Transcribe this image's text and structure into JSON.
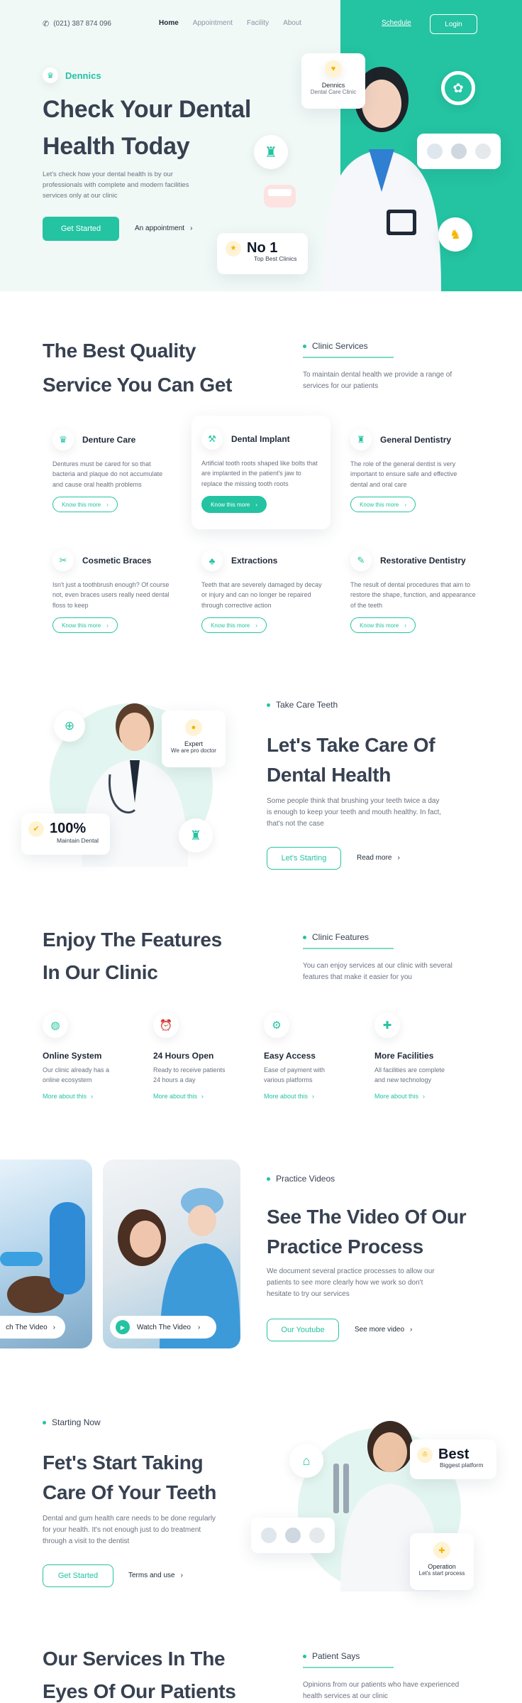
{
  "header": {
    "phone": "(021) 387 874 096",
    "nav": [
      "Home",
      "Appointment",
      "Facility",
      "About"
    ],
    "schedule": "Schedule",
    "login": "Login"
  },
  "hero": {
    "brand": "Dennics",
    "title_line1": "Check Your Dental",
    "title_line2": "Health Today",
    "description": "Let's check how your dental health is by our professionals with complete and modern facilities services only at our clinic",
    "cta_primary": "Get Started",
    "cta_secondary": "An appointment",
    "badge_brand_title": "Dennics",
    "badge_brand_sub": "Dental Care Clinic",
    "badge_no1_title": "No 1",
    "badge_no1_sub": "Top Best Clinics"
  },
  "services": {
    "title_line1": "The Best Quality",
    "title_line2": "Service You Can Get",
    "tag": "Clinic Services",
    "intro": "To maintain dental health we provide a range of services for our patients",
    "link_label": "Know this more",
    "items": [
      {
        "name": "Denture Care",
        "desc": "Dentures must be cared for so that bacteria and plaque do not accumulate and cause oral health problems",
        "icon": "denture-icon"
      },
      {
        "name": "Dental Implant",
        "desc": "Artificial tooth roots shaped like bolts that are implanted in the patient's jaw to replace the missing tooth roots",
        "icon": "implant-icon"
      },
      {
        "name": "General Dentistry",
        "desc": "The role of the general dentist is very important to ensure safe and effective dental and oral care",
        "icon": "tooth-icon"
      },
      {
        "name": "Cosmetic Braces",
        "desc": "Isn't just a toothbrush enough? Of course not, even braces users really need dental floss to keep",
        "icon": "braces-icon"
      },
      {
        "name": "Extractions",
        "desc": "Teeth that are severely damaged by decay or injury and can no longer be repaired through corrective action",
        "icon": "extraction-icon"
      },
      {
        "name": "Restorative Dentistry",
        "desc": "The result of dental procedures that aim to restore the shape, function, and appearance of the teeth",
        "icon": "restore-icon"
      }
    ]
  },
  "care": {
    "tag": "Take Care Teeth",
    "title_line1": "Let's Take Care Of",
    "title_line2": "Dental Health",
    "desc": "Some people think that brushing your teeth twice a day is enough to keep your teeth and mouth healthy. In fact, that's not the case",
    "cta_primary": "Let's Starting",
    "cta_secondary": "Read more",
    "badge_expert_title": "Expert",
    "badge_expert_sub": "We are pro doctor",
    "badge_pct_title": "100%",
    "badge_pct_sub": "Maintain Dental"
  },
  "features": {
    "title_line1": "Enjoy The Features",
    "title_line2": "In Our Clinic",
    "tag": "Clinic Features",
    "intro": "You can enjoy services at our clinic with several features that make it easier for you",
    "link_label": "More about this",
    "items": [
      {
        "name": "Online System",
        "desc": "Our clinic already has a online ecosystem",
        "icon": "globe-icon"
      },
      {
        "name": "24 Hours Open",
        "desc": "Ready to receive patients 24 hours a day",
        "icon": "alarm-clock-icon"
      },
      {
        "name": "Easy Access",
        "desc": "Ease of payment with various platforms",
        "icon": "access-icon"
      },
      {
        "name": "More Facilities",
        "desc": "All facilities are complete and new technology",
        "icon": "first-aid-icon"
      }
    ]
  },
  "videos": {
    "tag": "Practice Videos",
    "title_line1": "See The Video Of Our",
    "title_line2": "Practice Process",
    "desc": "We document several practice processes to allow our patients to see more clearly how we work so don't hesitate to try our services",
    "cta_primary": "Our Youtube",
    "cta_secondary": "See more video",
    "watch_label_1": "ch The Video",
    "watch_label_2": "Watch The Video"
  },
  "start": {
    "tag": "Starting Now",
    "title_line1": "Fet's Start Taking",
    "title_line2": "Care Of Your Teeth",
    "desc": "Dental and gum health care needs to be done regularly for your health. It's not enough just to do treatment through a visit to the dentist",
    "cta_primary": "Get Started",
    "cta_secondary": "Terms and use",
    "badge_best_title": "Best",
    "badge_best_sub": "Biggest platform",
    "badge_op_title": "Operation",
    "badge_op_sub": "Let's start process"
  },
  "patients": {
    "title_line1": "Our Services In The",
    "title_line2": "Eyes Of Our Patients",
    "tag": "Patient Says",
    "intro": "Opinions from our patients who have experienced health services at our clinic"
  },
  "colors": {
    "accent": "#24c3a2",
    "heading": "#374151",
    "body_text": "#6b7280",
    "hero_bg": "#eef8f5"
  }
}
